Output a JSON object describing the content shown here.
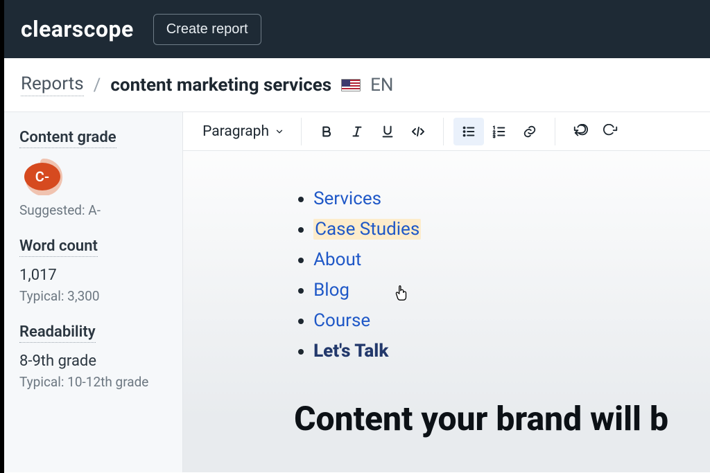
{
  "header": {
    "logo": "clearscope",
    "create_btn": "Create report"
  },
  "breadcrumbs": {
    "reports": "Reports",
    "sep": "/",
    "title": "content marketing services",
    "lang": "EN"
  },
  "sidebar": {
    "grade": {
      "label": "Content grade",
      "value": "C-",
      "suggested": "Suggested: A-"
    },
    "wordcount": {
      "label": "Word count",
      "value": "1,017",
      "typical": "Typical: 3,300"
    },
    "readability": {
      "label": "Readability",
      "value": "8-9th grade",
      "typical": "Typical: 10-12th grade"
    }
  },
  "toolbar": {
    "paragraph": "Paragraph"
  },
  "editor": {
    "items": [
      {
        "text": "Services"
      },
      {
        "text": "Case Studies"
      },
      {
        "text": "About"
      },
      {
        "text": "Blog"
      },
      {
        "text": "Course"
      },
      {
        "text": "Let's Talk"
      }
    ],
    "heading_partial": "Content your brand will b"
  }
}
